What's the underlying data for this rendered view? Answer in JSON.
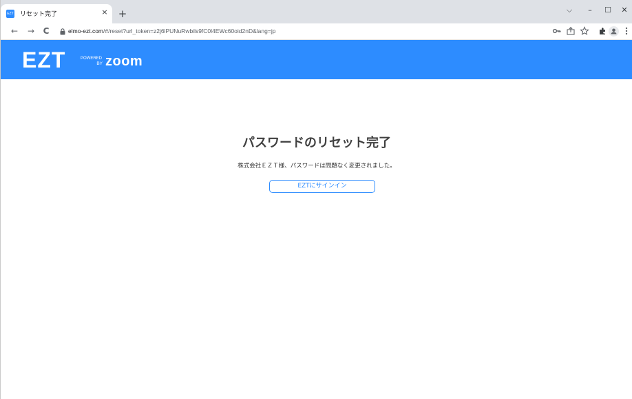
{
  "browser": {
    "tab": {
      "title": "リセット完了",
      "favicon_text": "EZT",
      "close_glyph": "×"
    },
    "new_tab_glyph": "+",
    "window_controls": {
      "dropdown": "⌵",
      "minimize": "–",
      "maximize": "☐",
      "close": "✕"
    },
    "nav": {
      "back": "←",
      "forward": "→",
      "reload": "C"
    },
    "address": {
      "host": "elmo-ezt.com",
      "path": "/#/reset?url_token=z2j6lPUNuRwbils9fC0l4EWc60oid2nD&lang=jp"
    },
    "toolbar_icons": [
      "key-icon",
      "share-icon",
      "star-icon",
      "extensions-icon",
      "profile-icon",
      "menu-icon"
    ]
  },
  "header": {
    "logo_text": "EZT",
    "powered_text": "POWERED",
    "by_text": "BY",
    "zoom_text": "zoom",
    "brand_color": "#2d8cff"
  },
  "main": {
    "title": "パスワードのリセット完了",
    "message": "株式会社ＥＺＴ様、パスワードは問題なく変更されました。",
    "signin_button": "EZTにサインイン"
  }
}
